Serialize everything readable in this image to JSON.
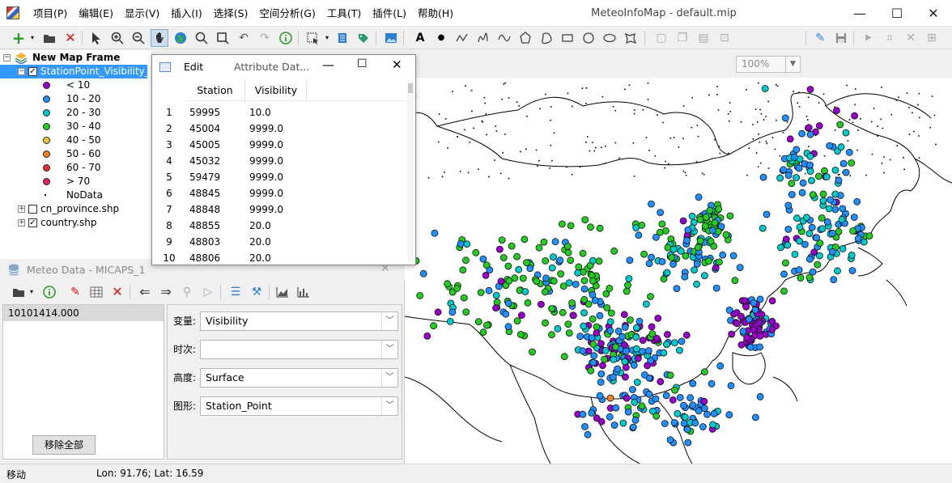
{
  "window": {
    "title": "MeteoInfoMap - default.mip",
    "minimize_glyph": "—",
    "maximize_glyph": "☐",
    "close_glyph": "✕"
  },
  "menu": [
    "项目(P)",
    "编辑(E)",
    "显示(V)",
    "插入(I)",
    "选择(S)",
    "空间分析(G)",
    "工具(T)",
    "插件(L)",
    "帮助(H)"
  ],
  "toolbar": {
    "zoom_value": "100%",
    "icons": [
      "add-icon",
      "open-icon",
      "remove-icon",
      "select-icon",
      "zoom-in-icon",
      "zoom-out-icon",
      "pan-icon",
      "full-extent-icon",
      "magnifier-icon",
      "zoom-box-icon",
      "undo-icon",
      "redo-icon",
      "identify-icon",
      "select-features-icon",
      "measure-icon",
      "label-icon",
      "picture-icon",
      "text-icon",
      "point-icon",
      "polyline-icon",
      "freehand-icon",
      "curve-icon",
      "polygon-icon",
      "curve-polygon-icon",
      "rectangle-icon",
      "circle-icon",
      "ellipse-icon",
      "freehand-polygon-icon",
      "edit-icon",
      "save-icon",
      "start-edit-icon",
      "vertex-icon",
      "delete-icon",
      "more-icon"
    ]
  },
  "legend": {
    "map_frame": "New Map Frame",
    "layer": "StationPoint_Visibility_",
    "classes": [
      {
        "label": "< 10",
        "color": "#9900cc"
      },
      {
        "label": "10 - 20",
        "color": "#1e90ff"
      },
      {
        "label": "20 - 30",
        "color": "#00cccc"
      },
      {
        "label": "30 - 40",
        "color": "#22cc22"
      },
      {
        "label": "40 - 50",
        "color": "#e6c83c"
      },
      {
        "label": "50 - 60",
        "color": "#f08020"
      },
      {
        "label": "60 - 70",
        "color": "#e83030"
      },
      {
        "label": "> 70",
        "color": "#e0206a"
      },
      {
        "label": "NoData",
        "color": "#000000"
      }
    ],
    "other_layers": [
      "cn_province.shp",
      "country.shp"
    ]
  },
  "attribute_window": {
    "tab_edit": "Edit",
    "title": "Attribute Dat...",
    "columns": [
      "Station",
      "Visibility"
    ],
    "rows": [
      [
        "1",
        "59995",
        "10.0"
      ],
      [
        "2",
        "45004",
        "9999.0"
      ],
      [
        "3",
        "45005",
        "9999.0"
      ],
      [
        "4",
        "45032",
        "9999.0"
      ],
      [
        "5",
        "59479",
        "9999.0"
      ],
      [
        "6",
        "48845",
        "9999.0"
      ],
      [
        "7",
        "48848",
        "9999.0"
      ],
      [
        "8",
        "48855",
        "20.0"
      ],
      [
        "9",
        "48803",
        "20.0"
      ],
      [
        "10",
        "48806",
        "20.0"
      ]
    ]
  },
  "meteo_panel": {
    "title": "Meteo Data - MICAPS_1",
    "file": "10101414.000",
    "remove_all": "移除全部",
    "fields": [
      {
        "label": "变量:",
        "value": "Visibility"
      },
      {
        "label": "时次:",
        "value": ""
      },
      {
        "label": "高度:",
        "value": "Surface"
      },
      {
        "label": "图形:",
        "value": "Station_Point"
      }
    ]
  },
  "status": {
    "mode": "移动",
    "coords": "Lon: 91.76; Lat: 16.59"
  }
}
